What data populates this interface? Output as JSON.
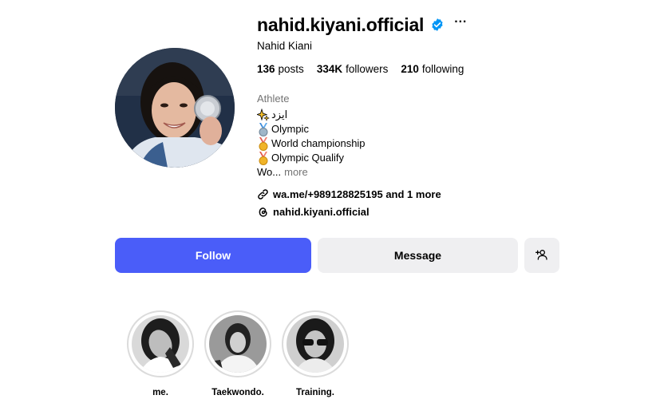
{
  "profile": {
    "username": "nahid.kiyani.official",
    "full_name": "Nahid Kiani",
    "more_icon": "ellipsis-icon",
    "verified_icon": "verified-badge-icon",
    "verified_color": "#0095f6"
  },
  "stats": {
    "posts_count": "136",
    "posts_label": "posts",
    "followers_count": "334K",
    "followers_label": "followers",
    "following_count": "210",
    "following_label": "following"
  },
  "bio": {
    "category": "Athlete",
    "line1": "ایزد",
    "line2": "Olympic",
    "line3": "World championship",
    "line4": "Olympic Qualify",
    "truncated": "Wo...",
    "more": "more",
    "medal_silver_color": "#9fb6c8",
    "medal_gold_color": "#f0b429",
    "ribbon_color": "#e2584b"
  },
  "links": {
    "website": "wa.me/+989128825195 and 1 more",
    "website_icon": "link-icon",
    "threads": "nahid.kiyani.official",
    "threads_icon": "threads-icon"
  },
  "actions": {
    "follow_label": "Follow",
    "message_label": "Message",
    "add_user_icon": "add-user-icon",
    "follow_color": "#4a5df9"
  },
  "highlights": [
    {
      "label": "me."
    },
    {
      "label": "Taekwondo."
    },
    {
      "label": "Training."
    }
  ]
}
